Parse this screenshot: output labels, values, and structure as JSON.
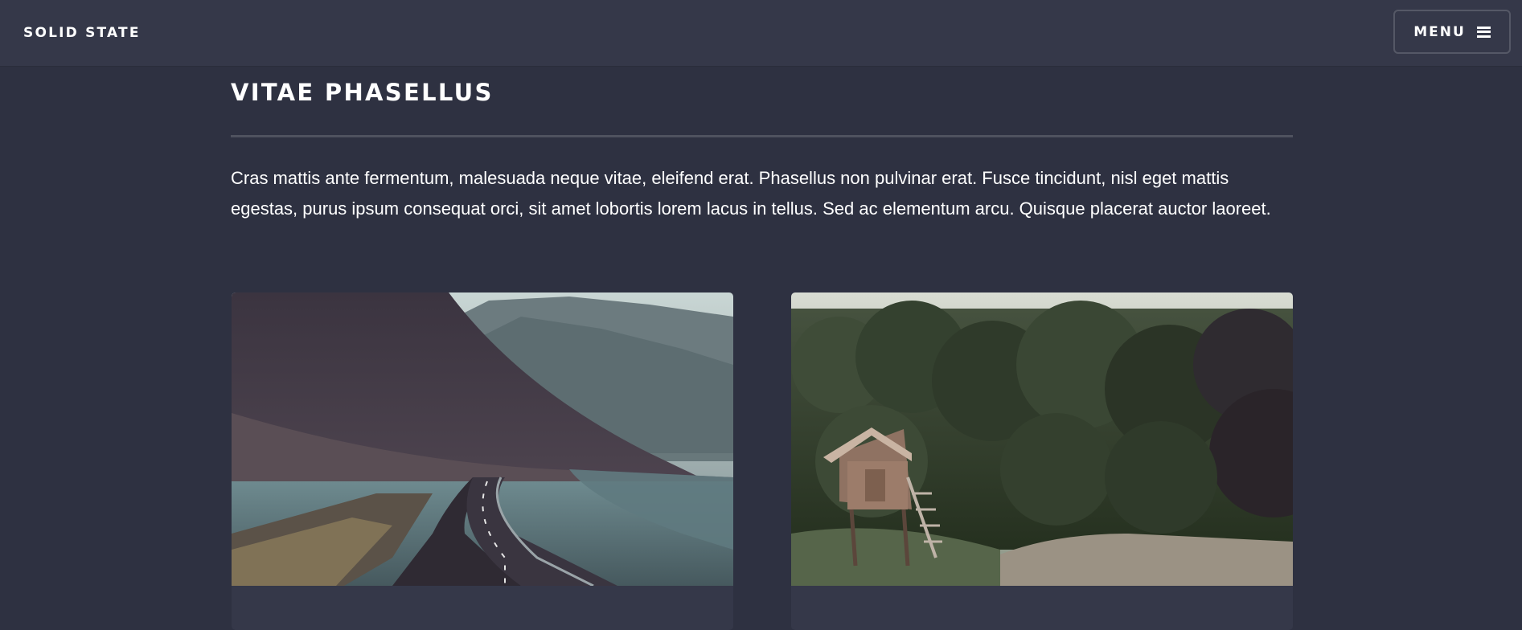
{
  "header": {
    "brand": "SOLID STATE",
    "menu_label": "MENU",
    "menu_icon": "hamburger-icon"
  },
  "main": {
    "title": "VITAE PHASELLUS",
    "intro": "Cras mattis ante fermentum, malesuada neque vitae, eleifend erat. Phasellus non pulvinar erat. Fusce tincidunt, nisl eget mattis egestas, purus ipsum consequat orci, sit amet lobortis lorem lacus in tellus. Sed ac elementum arcu. Quisque placerat auctor laoreet.",
    "cards": [
      {
        "image": "mountain-road-photo"
      },
      {
        "image": "forest-cabin-photo"
      }
    ]
  },
  "colors": {
    "background": "#2e3141",
    "header": "#353849",
    "card": "#353849",
    "text": "#ffffff"
  }
}
